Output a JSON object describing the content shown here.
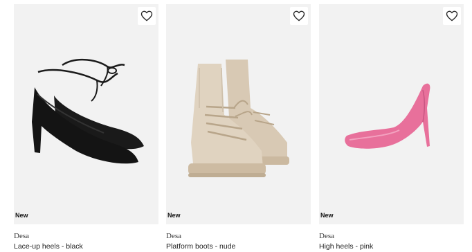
{
  "products": [
    {
      "badge": "New",
      "brand": "Desa",
      "name": "Lace-up heels - black",
      "icon": "heart-icon"
    },
    {
      "badge": "New",
      "brand": "Desa",
      "name": "Platform boots - nude",
      "icon": "heart-icon"
    },
    {
      "badge": "New",
      "brand": "Desa",
      "name": "High heels - pink",
      "icon": "heart-icon"
    }
  ],
  "colors": {
    "card_bg": "#f2f2f2",
    "black_shoe": "#1a1a1a",
    "nude_boot": "#ddd0bd",
    "pink_heel": "#e8709b"
  }
}
